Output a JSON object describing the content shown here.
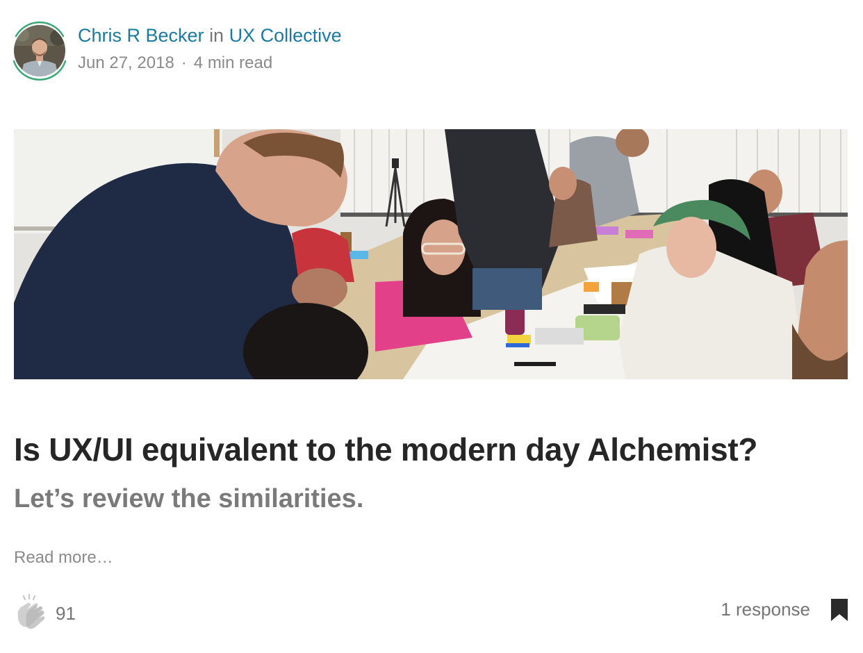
{
  "author": {
    "name": "Chris R Becker",
    "in_word": "in",
    "publication": "UX Collective",
    "date": "Jun 27, 2018",
    "separator": "·",
    "read_time": "4 min read",
    "ring_color": "#3aa878"
  },
  "article": {
    "title": "Is UX/UI equivalent to the modern day Alchemist?",
    "subtitle": "Let’s review the similarities.",
    "read_more": "Read more…"
  },
  "footer": {
    "clap_count": "91",
    "responses": "1 response",
    "clap_icon": "clap-icon",
    "bookmark_icon": "bookmark-icon"
  },
  "colors": {
    "link": "#1a7aa2",
    "text": "#262626",
    "muted": "#757575"
  }
}
